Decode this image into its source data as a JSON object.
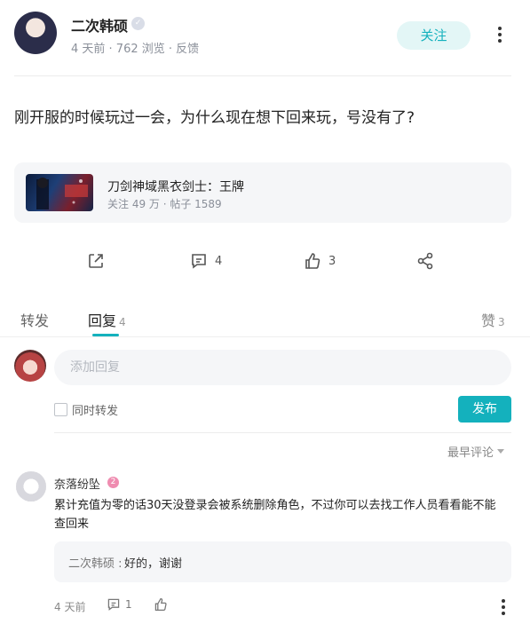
{
  "author": {
    "name": "二次韩硕",
    "badge_icon": "verified-badge-icon",
    "meta": "4 天前 · 762 浏览 · 反馈"
  },
  "follow_label": "关注",
  "post": {
    "text": "刚开服的时候玩过一会，为什么现在想下回来玩，号没有了?"
  },
  "game": {
    "title": "刀剑神域黑衣剑士：王牌",
    "meta": "关注 49 万 · 帖子 1589"
  },
  "actions": {
    "share_icon": "external-share-icon",
    "comment_count": "4",
    "like_count": "3",
    "more_share_icon": "share-nodes-icon"
  },
  "tabs": {
    "repost": "转发",
    "reply": "回复",
    "reply_count": "4",
    "like": "赞",
    "like_count": "3"
  },
  "composer": {
    "placeholder": "添加回复",
    "repost_label": "同时转发",
    "publish_label": "发布"
  },
  "sort_label": "最早评论",
  "comment": {
    "user": "奈落纷坠",
    "level": "2",
    "text": "累计充值为零的话30天没登录会被系统删除角色，不过你可以去找工作人员看看能不能查回来",
    "reply_author": "二次韩硕 :",
    "reply_text": "好的，谢谢",
    "time": "4 天前",
    "reply_count": "1"
  },
  "colors": {
    "accent": "#14b1bd",
    "follow_bg": "#e3f6f6",
    "card_bg": "#f5f6f8"
  }
}
